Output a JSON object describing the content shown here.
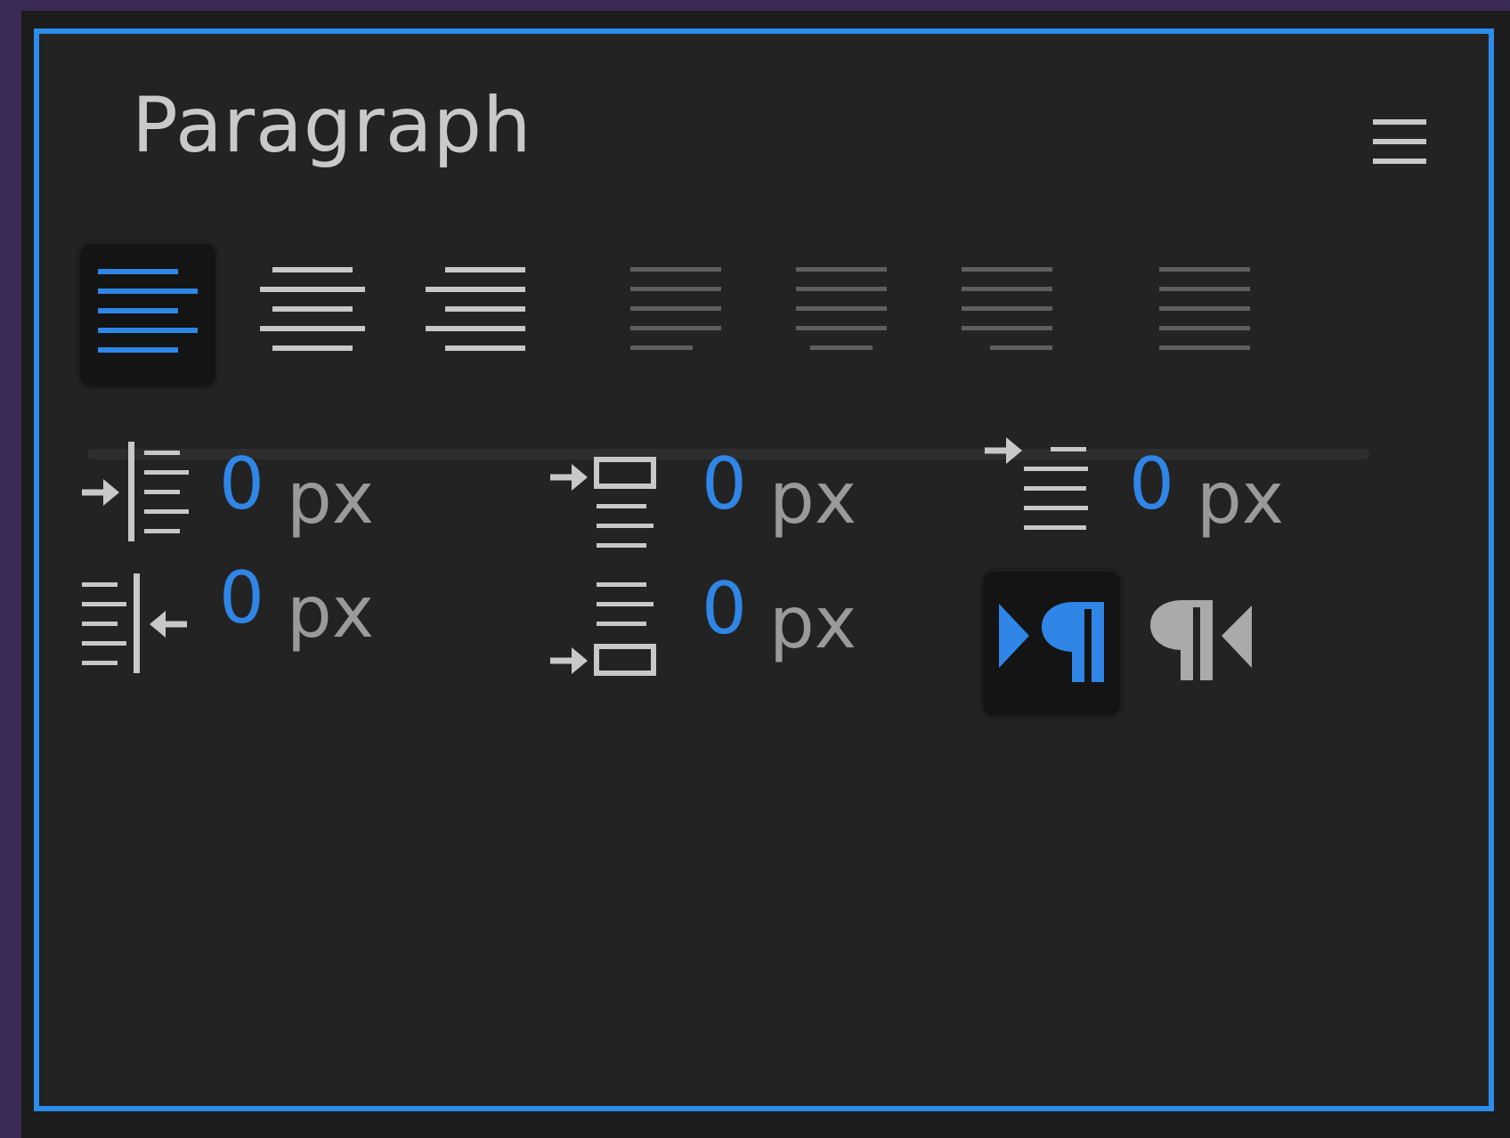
{
  "panel": {
    "title": "Paragraph",
    "menu_icon": "hamburger-menu-icon"
  },
  "alignment": {
    "buttons": [
      {
        "name": "align-left",
        "selected": true,
        "enabled": true
      },
      {
        "name": "align-center",
        "selected": false,
        "enabled": true
      },
      {
        "name": "align-right",
        "selected": false,
        "enabled": true
      },
      {
        "name": "justify-last-left",
        "selected": false,
        "enabled": false
      },
      {
        "name": "justify-last-center",
        "selected": false,
        "enabled": false
      },
      {
        "name": "justify-last-right",
        "selected": false,
        "enabled": false
      },
      {
        "name": "justify-all",
        "selected": false,
        "enabled": false
      }
    ]
  },
  "indents": {
    "left_indent": {
      "value": "0",
      "unit": "px",
      "icon": "indent-left-icon"
    },
    "space_before": {
      "value": "0",
      "unit": "px",
      "icon": "space-before-paragraph-icon"
    },
    "first_line_indent": {
      "value": "0",
      "unit": "px",
      "icon": "indent-first-line-icon"
    },
    "right_indent": {
      "value": "0",
      "unit": "px",
      "icon": "indent-right-icon"
    },
    "space_after": {
      "value": "0",
      "unit": "px",
      "icon": "space-after-paragraph-icon"
    }
  },
  "direction": {
    "ltr": {
      "icon": "left-to-right-paragraph-icon",
      "selected": true
    },
    "rtl": {
      "icon": "right-to-left-paragraph-icon",
      "selected": false
    }
  },
  "colors": {
    "accent": "#2d8ceb",
    "panel_bg": "#232323",
    "icon_gray": "#c8c8c8",
    "disabled_gray": "#5e5e5e"
  }
}
